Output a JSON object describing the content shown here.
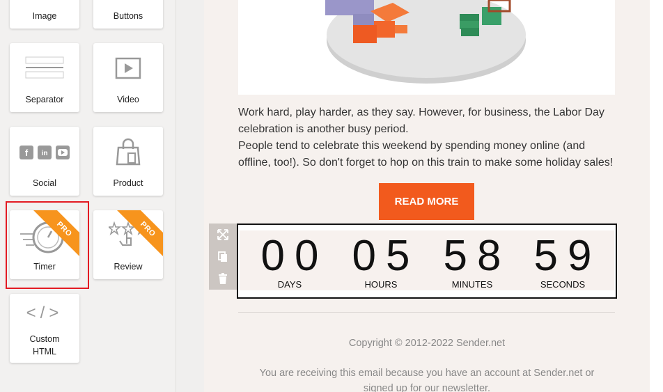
{
  "palette": {
    "blocks": [
      {
        "label": "Image",
        "icon": "image-icon"
      },
      {
        "label": "Buttons",
        "icon": "buttons-icon"
      },
      {
        "label": "Separator",
        "icon": "separator-icon"
      },
      {
        "label": "Video",
        "icon": "video-icon"
      },
      {
        "label": "Social",
        "icon": "social-icon"
      },
      {
        "label": "Product",
        "icon": "shopping-bag-icon"
      },
      {
        "label": "Timer",
        "icon": "stopwatch-icon",
        "badge": "PRO"
      },
      {
        "label": "Review",
        "icon": "stars-hand-icon",
        "badge": "PRO"
      },
      {
        "label": "Custom\nHTML",
        "icon": "code-icon"
      }
    ],
    "highlighted": "Timer"
  },
  "email": {
    "paragraph1_line1": "Work hard, play harder, as they say. However, for business, the Labor Day",
    "paragraph1_line2": "celebration is another busy period.",
    "paragraph2_line1": "People tend to celebrate this weekend by spending money online (and",
    "paragraph2_line2": "offline, too!). So don't forget to hop on this train to make some holiday sales!",
    "button_label": "READ MORE",
    "countdown": [
      {
        "value": "00",
        "unit": "DAYS"
      },
      {
        "value": "05",
        "unit": "HOURS"
      },
      {
        "value": "58",
        "unit": "MINUTES"
      },
      {
        "value": "59",
        "unit": "SECONDS"
      }
    ],
    "footer_copyright": "Copyright © 2012-2022 Sender.net",
    "footer_notice_line1": "You are receiving this email because you have an account at Sender.net or",
    "footer_notice_line2": "signed up for our newsletter."
  },
  "colors": {
    "accent": "#f25a1d",
    "pro_badge": "#f7941d",
    "highlight": "#e31b23"
  }
}
